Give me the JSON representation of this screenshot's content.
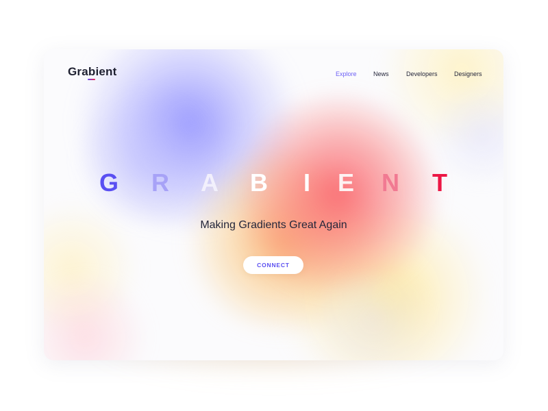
{
  "brand": {
    "name": "Grabient"
  },
  "nav": {
    "items": [
      {
        "label": "Explore",
        "active": true
      },
      {
        "label": "News",
        "active": false
      },
      {
        "label": "Developers",
        "active": false
      },
      {
        "label": "Designers",
        "active": false
      }
    ]
  },
  "hero": {
    "letters": [
      "G",
      "R",
      "A",
      "B",
      "I",
      "E",
      "N",
      "T"
    ],
    "subtitle": "Making Gradients Great Again",
    "cta_label": "CONNECT"
  },
  "colors": {
    "accent_purple": "#5b4ff0",
    "accent_red": "#ec1745",
    "text_dark": "#23253a"
  }
}
